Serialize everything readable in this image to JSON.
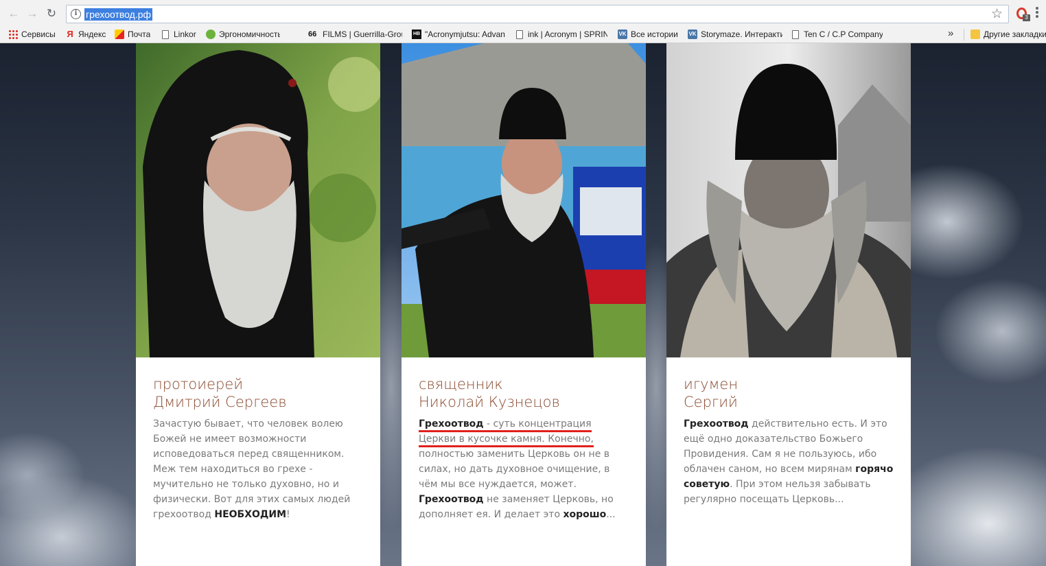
{
  "browser": {
    "url": "грехоотвод.рф",
    "extension_badge": "3",
    "bookmarks": [
      {
        "label": "Сервисы",
        "icon": "apps-grid-icon"
      },
      {
        "label": "Яндекс",
        "icon": "yandex-icon"
      },
      {
        "label": "Почта",
        "icon": "mail-icon"
      },
      {
        "label": "Linkor",
        "icon": "page-icon"
      },
      {
        "label": "Эргономичность, ми",
        "icon": "ergo-icon"
      },
      {
        "label": "FILMS | Guerrilla-Grou",
        "icon": "films-66-icon"
      },
      {
        "label": "\"Acronymjutsu: Advan",
        "icon": "nb-icon"
      },
      {
        "label": "ink | Acronym | SPRIN",
        "icon": "page-icon"
      },
      {
        "label": "Все истории",
        "icon": "vk-icon"
      },
      {
        "label": "Storymaze. Интеракти",
        "icon": "vk-icon"
      },
      {
        "label": "Ten C / C.P Company",
        "icon": "page-icon"
      }
    ],
    "bookmarks_more": "»",
    "other_bookmarks": "Другие закладки",
    "icon_glyphs": {
      "yandex": "Я",
      "films": "66",
      "nb": "НВ",
      "vk": "VK"
    }
  },
  "cards": [
    {
      "rank": "протоиерей",
      "name": "Дмитрий Сергеев",
      "text": [
        {
          "t": "Зачастую бывает, что человек волею Божей не имеет возможности исповедоваться перед священником. Меж тем находиться во грехе - мучительно не только духовно, но и физически. Вот для этих самых людей грехоотвод "
        },
        {
          "t": "НЕОБХОДИМ",
          "bold": true
        },
        {
          "t": "!"
        }
      ]
    },
    {
      "rank": "священник",
      "name": "Николай Кузнецов",
      "text": [
        {
          "t": "Грехоотвод",
          "bold": true,
          "underline": true
        },
        {
          "t": " - суть концентрация Церкви в кусочке камня. Конечно,",
          "underline": true
        },
        {
          "t": " полностью заменить Церковь он не в силах, но дать духовное очищение, в чём мы все нуждается, может. "
        },
        {
          "t": "Грехоотвод",
          "bold": true
        },
        {
          "t": " не заменяет Церковь, но дополняет ея. И делает это "
        },
        {
          "t": "хорошо",
          "bold": true
        },
        {
          "t": "..."
        }
      ]
    },
    {
      "rank": "игумен",
      "name": "Сергий",
      "text": [
        {
          "t": "Грехоотвод",
          "bold": true
        },
        {
          "t": " действительно есть. И это ещё одно доказательство Божьего Провидения. Сам я не пользуюсь, ибо облачен саном, но всем мирянам "
        },
        {
          "t": "горячо советую",
          "bold": true
        },
        {
          "t": ". При этом нельзя забывать регулярно посещать Церковь..."
        }
      ]
    }
  ],
  "colors": {
    "accent_title": "#8a4a2f",
    "body_text": "#7a7a7a",
    "underline": "#e0201b"
  }
}
